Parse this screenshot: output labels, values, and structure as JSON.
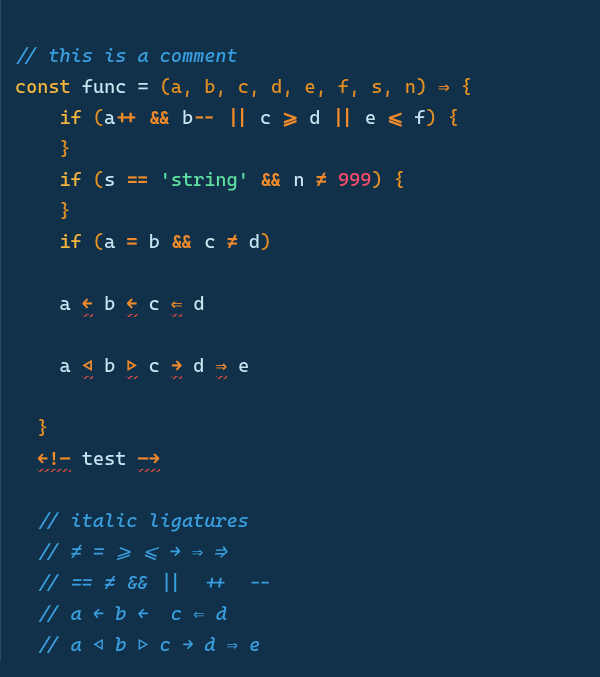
{
  "lines": {
    "l1_comment": "// this is a comment",
    "l2": {
      "const": "const",
      "func": "func",
      "eq": "=",
      "args": "(a, b, c, d, e, f, s, n)",
      "arrow": "⇒",
      "brace": "{"
    },
    "l3": {
      "if": "if",
      "lp": "(",
      "a": "a",
      "inc": "++",
      "and": "&&",
      "b": "b",
      "dec": "--",
      "or1": "||",
      "c": "c",
      "ge": "⩾",
      "d": "d",
      "or2": "||",
      "e": "e",
      "le": "⩽",
      "f": "f",
      "rp": ")",
      "brace": "{"
    },
    "l4": {
      "brace": "}"
    },
    "l5": {
      "if": "if",
      "lp": "(",
      "s": "s",
      "eqeq": "==",
      "str": "'string'",
      "and": "&&",
      "n": "n",
      "neq": "≠",
      "num": "999",
      "rp": ")",
      "brace": "{"
    },
    "l6": {
      "brace": "}"
    },
    "l7": {
      "if": "if",
      "lp": "(",
      "a": "a",
      "eq": "=",
      "b": "b",
      "and": "&&",
      "c": "c",
      "neq": "≠",
      "d": "d",
      "rp": ")"
    },
    "l8_blank": " ",
    "l9": {
      "a": "a",
      "ar1": "←",
      "b": "b",
      "ar2": "←",
      "c": "c",
      "ar3": "⇐",
      "d": "d"
    },
    "l10_blank": " ",
    "l11": {
      "a": "a",
      "tl": "◁",
      "b": "b",
      "tr": "▷",
      "c": "c",
      "ar1": "→",
      "d": "d",
      "ar2": "⇒",
      "e": "e"
    },
    "l12_blank": " ",
    "l13": {
      "brace": "}"
    },
    "l14": {
      "open": "←!—",
      "text": "test",
      "close": "—→"
    },
    "l15_blank": " ",
    "l16": "// italic ligatures",
    "l17": "// ≠ = ⩾ ⩽ → ⇒ ⟹",
    "l18": "// == ≠ && ||  ++  --",
    "l19": "// a ← b ←  c ⇐ d",
    "l20": "// a ◁ b ▷ c → d ⇒ e"
  },
  "colors": {
    "background": "#103149",
    "comment": "#3a9fe0",
    "keyword": "#f5b63e",
    "identifier": "#c8e4f2",
    "operator": "#f08a2b",
    "paren": "#e28f24",
    "string": "#5ee0a0",
    "number": "#ff4d6a",
    "error_underline": "#d14b3f"
  }
}
